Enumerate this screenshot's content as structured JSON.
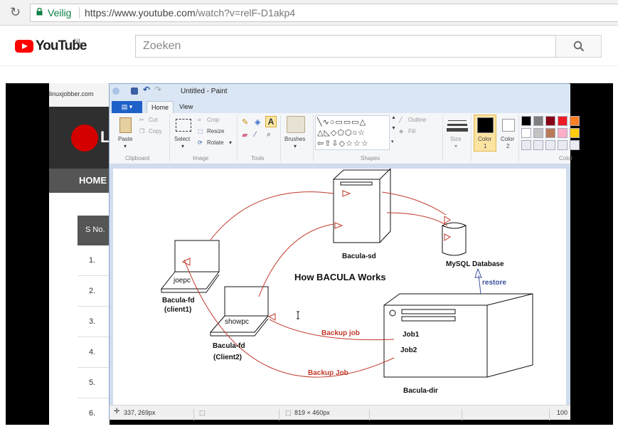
{
  "browser": {
    "security_label": "Veilig",
    "url_prefix": "https://www.youtube.com",
    "url_path": "/watch?v=relF-D1akp4"
  },
  "youtube": {
    "logo_text": "YouTube",
    "country_code": "NL",
    "search_placeholder": "Zoeken"
  },
  "website": {
    "address": "linuxjobber.com",
    "logo_letter": "L",
    "nav_home": "HOME",
    "table_header": "S No.",
    "rows": [
      "1.",
      "2.",
      "3.",
      "4.",
      "5.",
      "6."
    ]
  },
  "paint": {
    "title": "Untitled - Paint",
    "tabs": {
      "home": "Home",
      "view": "View"
    },
    "ribbon": {
      "paste": "Paste",
      "cut": "Cut",
      "copy": "Copy",
      "clipboard": "Clipboard",
      "select": "Select",
      "crop": "Crop",
      "resize": "Resize",
      "rotate": "Rotate",
      "image": "Image",
      "tools": "Tools",
      "brushes": "Brushes",
      "shapes": "Shapes",
      "outline": "Outline",
      "fill": "Fill",
      "size": "Size",
      "color1": "Color",
      "color1_num": "1",
      "color2": "Color",
      "color2_num": "2",
      "colors": "Color"
    },
    "palette": [
      "#000000",
      "#7f7f7f",
      "#880015",
      "#ed1c24",
      "#ff7f27",
      "#ffffff",
      "#c3c3c3",
      "#b97a57",
      "#ffaec9",
      "#ffc90e"
    ],
    "status": {
      "cursor_pos": "337, 269px",
      "canvas_size": "819 × 460px",
      "zoom": "100"
    }
  },
  "diagram": {
    "server_label": "Bacula-sd",
    "title": "How BACULA Works",
    "db_label": "MySQL Database",
    "restore_label": "restore",
    "client1_name": "joepc",
    "client1_label1": "Bacula-fd",
    "client1_label2": "(client1)",
    "client2_name": "showpc",
    "client2_label1": "Bacula-fd",
    "client2_label2": "(Client2)",
    "job1_label": "Job1",
    "job2_label": "Job2",
    "backup_job_top": "Backup  job",
    "backup_job_bottom": "Backup Job",
    "dir_label": "Bacula-dir",
    "info_mark": "i"
  }
}
